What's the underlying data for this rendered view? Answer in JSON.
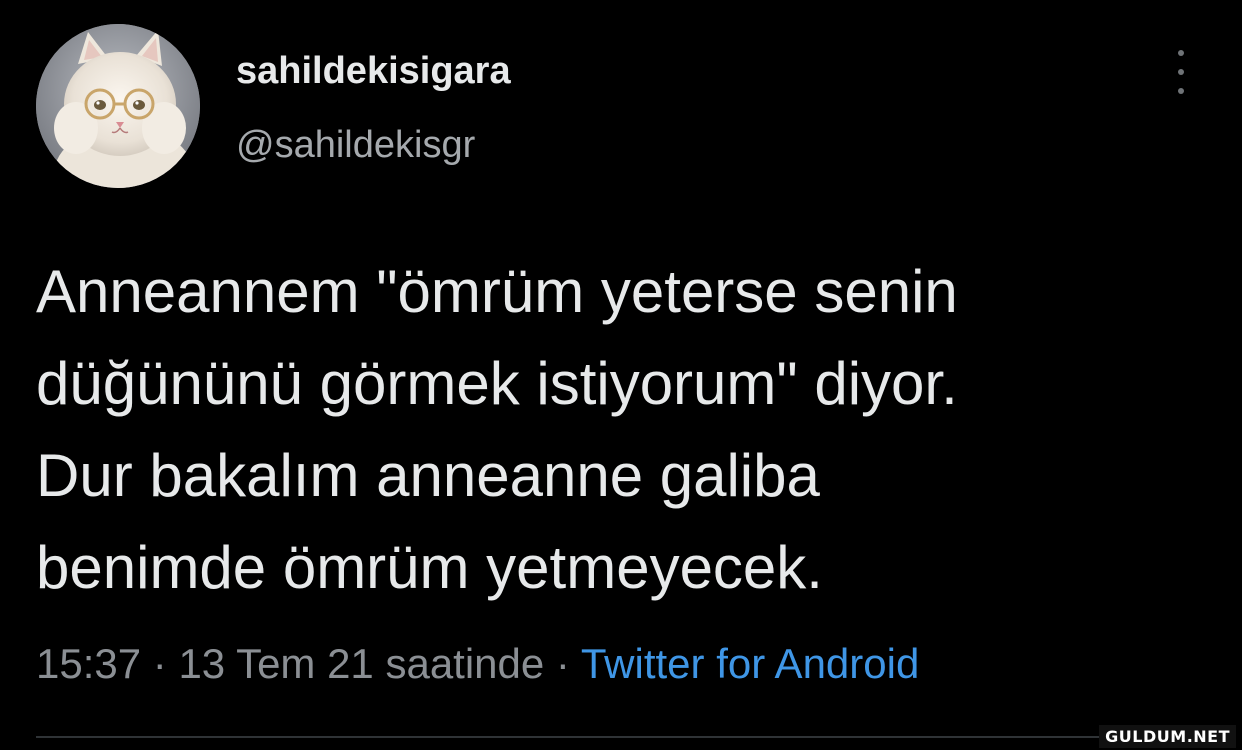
{
  "account": {
    "display_name": "sahildekisigara",
    "handle": "@sahildekisgr",
    "avatar_icon": "cat-with-glasses-avatar"
  },
  "more_menu_icon": "vertical-ellipsis-icon",
  "tweet": {
    "lines": [
      "Anneannem \"ömrüm yeterse senin",
      "düğününü görmek istiyorum\" diyor.",
      "Dur bakalım anneanne galiba",
      "benimde ömrüm yetmeyecek."
    ]
  },
  "meta": {
    "time": "15:37",
    "separator1": " · ",
    "date_text": "13 Tem 21 saatinde",
    "separator2": " · ",
    "source": "Twitter for Android"
  },
  "colors": {
    "background": "#000000",
    "text": "#e7e9ea",
    "muted": "#8b8f94",
    "link": "#3f96e6"
  },
  "watermark": "GULDUM.NET"
}
